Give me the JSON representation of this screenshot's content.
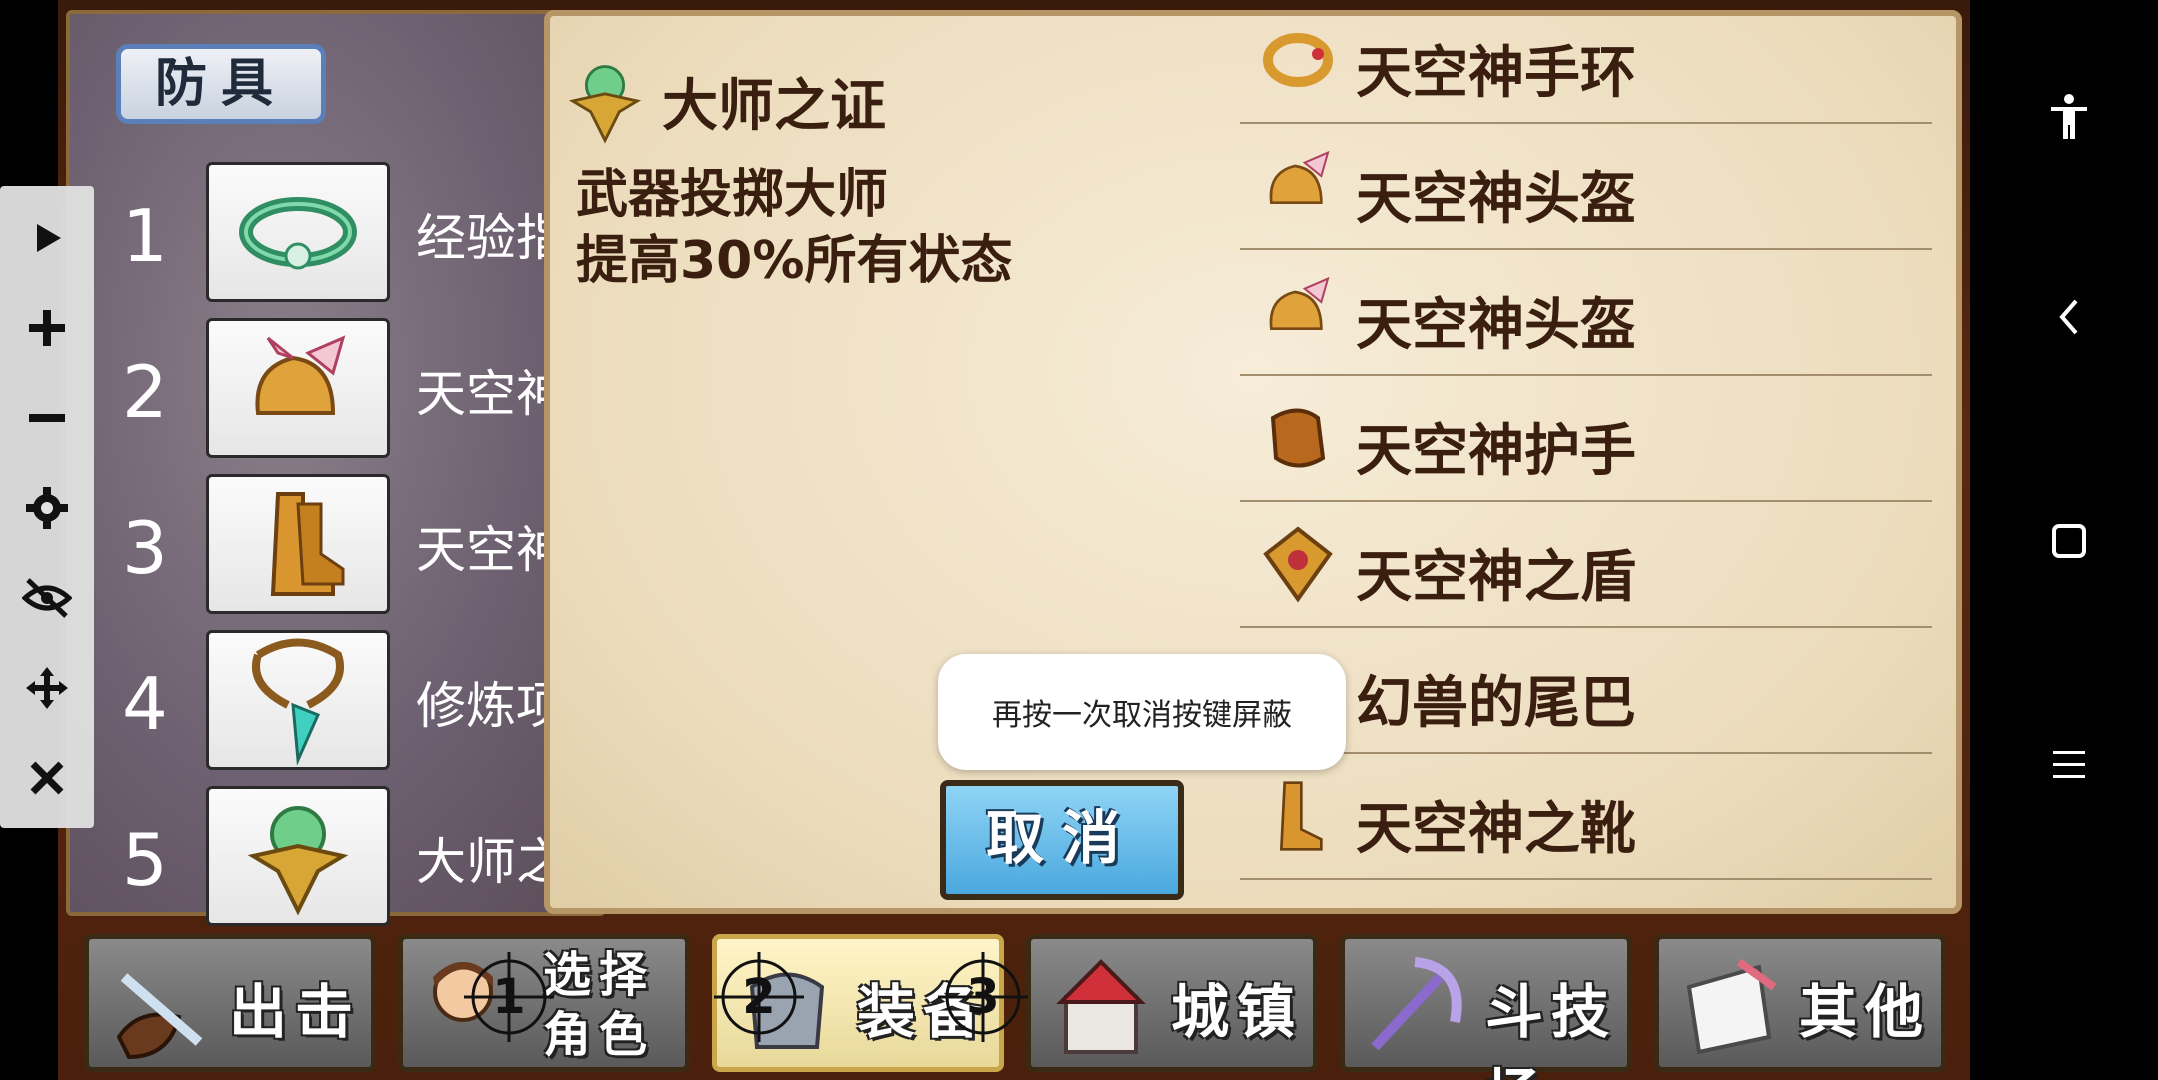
{
  "armor_panel": {
    "title": "防具",
    "rows": [
      {
        "num": "1",
        "name": "经验指",
        "icon": "ring-icon"
      },
      {
        "num": "2",
        "name": "天空神",
        "icon": "helmet-icon"
      },
      {
        "num": "3",
        "name": "天空神",
        "icon": "boots-icon"
      },
      {
        "num": "4",
        "name": "修炼项",
        "icon": "necklace-icon"
      },
      {
        "num": "5",
        "name": "大师之",
        "icon": "medal-icon"
      }
    ]
  },
  "detail": {
    "item_name": "大师之证",
    "line1": "武器投掷大师",
    "line2": "提高30%所有状态"
  },
  "equip_list": [
    {
      "label": "天空神手环",
      "icon": "bracelet-icon"
    },
    {
      "label": "天空神头盔",
      "icon": "helmet-icon"
    },
    {
      "label": "天空神头盔",
      "icon": "helmet-icon"
    },
    {
      "label": "天空神护手",
      "icon": "gauntlet-icon"
    },
    {
      "label": "天空神之盾",
      "icon": "shield-icon"
    },
    {
      "label": "幻兽的尾巴",
      "icon": "tail-icon"
    },
    {
      "label": "天空神之靴",
      "icon": "boots-icon"
    }
  ],
  "toast": "再按一次取消按键屏蔽",
  "cancel_label": "取消",
  "menu": {
    "sortie": "出击",
    "select_role_1": "选择",
    "select_role_2": "角色",
    "equip": "装备",
    "town": "城镇",
    "arena": "斗技场",
    "other": "其他",
    "crosshairs": [
      "1",
      "2",
      "3"
    ]
  },
  "colors": {
    "parchment": "#f3e7cf",
    "text_brown": "#3a1e10",
    "cancel_blue": "#4aa8de",
    "frame": "#5a2a10"
  }
}
